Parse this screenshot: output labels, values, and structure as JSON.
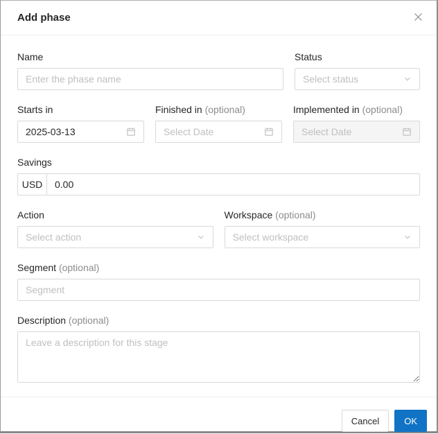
{
  "dialog": {
    "title": "Add phase"
  },
  "fields": {
    "name": {
      "label": "Name",
      "placeholder": "Enter the phase name"
    },
    "status": {
      "label": "Status",
      "placeholder": "Select status"
    },
    "starts_in": {
      "label": "Starts in",
      "value": "2025-03-13"
    },
    "finished_in": {
      "label": "Finished in",
      "optional": "(optional)",
      "placeholder": "Select Date"
    },
    "implemented_in": {
      "label": "Implemented in",
      "optional": "(optional)",
      "placeholder": "Select Date",
      "state": "disabled"
    },
    "savings": {
      "label": "Savings",
      "currency": "USD",
      "value": "0.00"
    },
    "action": {
      "label": "Action",
      "placeholder": "Select action"
    },
    "workspace": {
      "label": "Workspace",
      "optional": "(optional)",
      "placeholder": "Select workspace"
    },
    "segment": {
      "label": "Segment",
      "optional": "(optional)",
      "placeholder": "Segment"
    },
    "description": {
      "label": "Description",
      "optional": "(optional)",
      "placeholder": "Leave a description for this stage"
    }
  },
  "footer": {
    "cancel_label": "Cancel",
    "ok_label": "OK"
  },
  "colors": {
    "primary": "#1173c5",
    "border": "#d9d9d9",
    "placeholder": "#bfbfbf",
    "disabled_bg": "#f5f5f5"
  }
}
